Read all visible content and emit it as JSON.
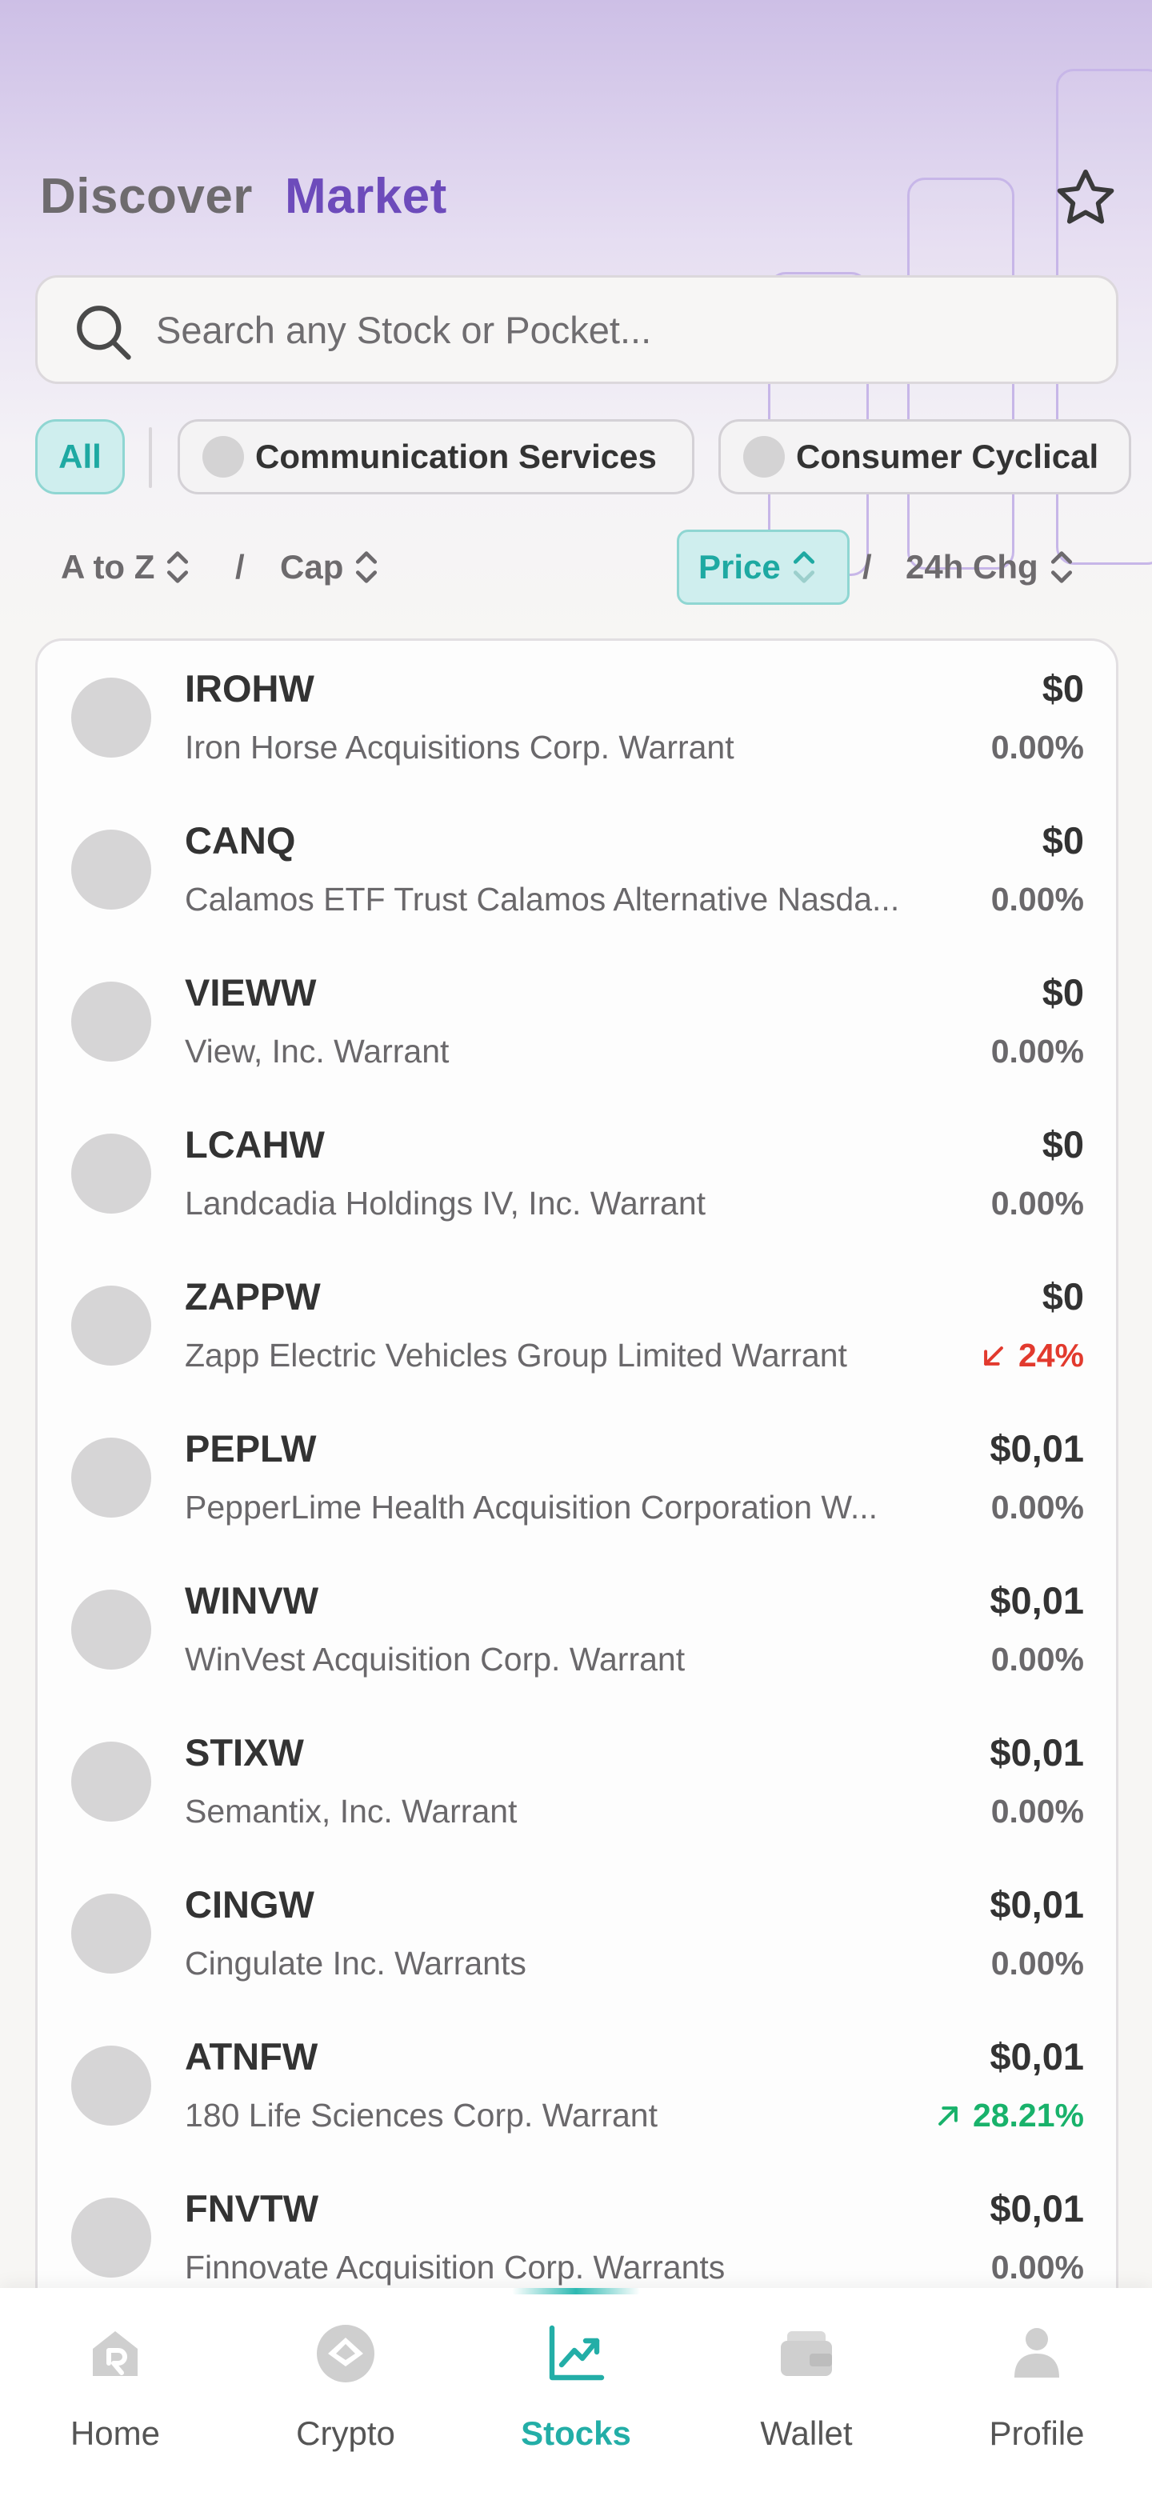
{
  "header": {
    "discover": "Discover",
    "market": "Market"
  },
  "search": {
    "placeholder": "Search any Stock or Pocket..."
  },
  "filters": {
    "all": "All",
    "chips": [
      "Communication Services",
      "Consumer Cyclical"
    ]
  },
  "sort": {
    "a_to_z": "A to Z",
    "cap": "Cap",
    "price": "Price",
    "change_24h": "24h Chg",
    "separator": "/"
  },
  "stocks": [
    {
      "ticker": "IROHW",
      "name": "Iron Horse Acquisitions Corp. Warrant",
      "price": "$0",
      "change": "0.00%"
    },
    {
      "ticker": "CANQ",
      "name": "Calamos ETF Trust Calamos Alternative Nasda...",
      "price": "$0",
      "change": "0.00%"
    },
    {
      "ticker": "VIEWW",
      "name": "View, Inc. Warrant",
      "price": "$0",
      "change": "0.00%"
    },
    {
      "ticker": "LCAHW",
      "name": "Landcadia Holdings IV, Inc. Warrant",
      "price": "$0",
      "change": "0.00%"
    },
    {
      "ticker": "ZAPPW",
      "name": "Zapp Electric Vehicles Group Limited Warrant",
      "price": "$0",
      "change": "24%",
      "direction": "down"
    },
    {
      "ticker": "PEPLW",
      "name": "PepperLime Health Acquisition Corporation W...",
      "price": "$0,01",
      "change": "0.00%"
    },
    {
      "ticker": "WINVW",
      "name": "WinVest Acquisition Corp. Warrant",
      "price": "$0,01",
      "change": "0.00%"
    },
    {
      "ticker": "STIXW",
      "name": "Semantix, Inc. Warrant",
      "price": "$0,01",
      "change": "0.00%"
    },
    {
      "ticker": "CINGW",
      "name": "Cingulate Inc. Warrants",
      "price": "$0,01",
      "change": "0.00%"
    },
    {
      "ticker": "ATNFW",
      "name": "180 Life Sciences Corp. Warrant",
      "price": "$0,01",
      "change": "28.21%",
      "direction": "up"
    },
    {
      "ticker": "FNVTW",
      "name": "Finnovate Acquisition Corp. Warrants",
      "price": "$0,01",
      "change": "0.00%"
    }
  ],
  "tabbar": {
    "home": "Home",
    "crypto": "Crypto",
    "stocks": "Stocks",
    "wallet": "Wallet",
    "profile": "Profile",
    "active": "stocks"
  },
  "colors": {
    "accent_teal": "#23aea7",
    "brand_purple": "#6d4bbb",
    "negative_red": "#e23a2e",
    "positive_green": "#19b26b"
  },
  "icons": [
    "star-icon",
    "search-icon",
    "chevron-up-down-icon",
    "arrow-down-left-icon",
    "arrow-up-right-icon",
    "home-icon",
    "crypto-icon",
    "stocks-chart-icon",
    "wallet-icon",
    "profile-icon"
  ]
}
